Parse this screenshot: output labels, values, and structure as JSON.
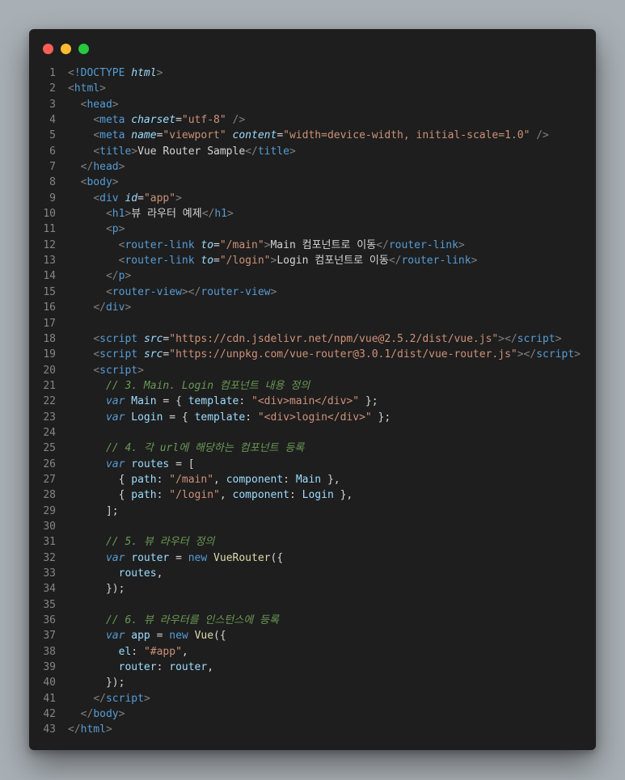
{
  "window": {
    "controls": [
      "close",
      "minimize",
      "maximize"
    ]
  },
  "lines": [
    [
      [
        "punct",
        "<"
      ],
      [
        "doctype",
        "!DOCTYPE "
      ],
      [
        "attr",
        "html"
      ],
      [
        "punct",
        ">"
      ]
    ],
    [
      [
        "punct",
        "<"
      ],
      [
        "tag",
        "html"
      ],
      [
        "punct",
        ">"
      ]
    ],
    [
      [
        "plain",
        "  "
      ],
      [
        "punct",
        "<"
      ],
      [
        "tag",
        "head"
      ],
      [
        "punct",
        ">"
      ]
    ],
    [
      [
        "plain",
        "    "
      ],
      [
        "punct",
        "<"
      ],
      [
        "tag",
        "meta"
      ],
      [
        "plain",
        " "
      ],
      [
        "attr",
        "charset"
      ],
      [
        "plain",
        "="
      ],
      [
        "str",
        "\"utf-8\""
      ],
      [
        "plain",
        " "
      ],
      [
        "punct",
        "/>"
      ]
    ],
    [
      [
        "plain",
        "    "
      ],
      [
        "punct",
        "<"
      ],
      [
        "tag",
        "meta"
      ],
      [
        "plain",
        " "
      ],
      [
        "attr",
        "name"
      ],
      [
        "plain",
        "="
      ],
      [
        "str",
        "\"viewport\""
      ],
      [
        "plain",
        " "
      ],
      [
        "attr",
        "content"
      ],
      [
        "plain",
        "="
      ],
      [
        "str",
        "\"width=device-width, initial-scale=1.0\""
      ],
      [
        "plain",
        " "
      ],
      [
        "punct",
        "/>"
      ]
    ],
    [
      [
        "plain",
        "    "
      ],
      [
        "punct",
        "<"
      ],
      [
        "tag",
        "title"
      ],
      [
        "punct",
        ">"
      ],
      [
        "text",
        "Vue Router Sample"
      ],
      [
        "punct",
        "</"
      ],
      [
        "tag",
        "title"
      ],
      [
        "punct",
        ">"
      ]
    ],
    [
      [
        "plain",
        "  "
      ],
      [
        "punct",
        "</"
      ],
      [
        "tag",
        "head"
      ],
      [
        "punct",
        ">"
      ]
    ],
    [
      [
        "plain",
        "  "
      ],
      [
        "punct",
        "<"
      ],
      [
        "tag",
        "body"
      ],
      [
        "punct",
        ">"
      ]
    ],
    [
      [
        "plain",
        "    "
      ],
      [
        "punct",
        "<"
      ],
      [
        "tag",
        "div"
      ],
      [
        "plain",
        " "
      ],
      [
        "attr",
        "id"
      ],
      [
        "plain",
        "="
      ],
      [
        "str",
        "\"app\""
      ],
      [
        "punct",
        ">"
      ]
    ],
    [
      [
        "plain",
        "      "
      ],
      [
        "punct",
        "<"
      ],
      [
        "tag",
        "h1"
      ],
      [
        "punct",
        ">"
      ],
      [
        "text",
        "뷰 라우터 예제"
      ],
      [
        "punct",
        "</"
      ],
      [
        "tag",
        "h1"
      ],
      [
        "punct",
        ">"
      ]
    ],
    [
      [
        "plain",
        "      "
      ],
      [
        "punct",
        "<"
      ],
      [
        "tag",
        "p"
      ],
      [
        "punct",
        ">"
      ]
    ],
    [
      [
        "plain",
        "        "
      ],
      [
        "punct",
        "<"
      ],
      [
        "tag",
        "router-link"
      ],
      [
        "plain",
        " "
      ],
      [
        "attr",
        "to"
      ],
      [
        "plain",
        "="
      ],
      [
        "str",
        "\"/main\""
      ],
      [
        "punct",
        ">"
      ],
      [
        "text",
        "Main 컴포넌트로 이동"
      ],
      [
        "punct",
        "</"
      ],
      [
        "tag",
        "router-link"
      ],
      [
        "punct",
        ">"
      ]
    ],
    [
      [
        "plain",
        "        "
      ],
      [
        "punct",
        "<"
      ],
      [
        "tag",
        "router-link"
      ],
      [
        "plain",
        " "
      ],
      [
        "attr",
        "to"
      ],
      [
        "plain",
        "="
      ],
      [
        "str",
        "\"/login\""
      ],
      [
        "punct",
        ">"
      ],
      [
        "text",
        "Login 컴포넌트로 이동"
      ],
      [
        "punct",
        "</"
      ],
      [
        "tag",
        "router-link"
      ],
      [
        "punct",
        ">"
      ]
    ],
    [
      [
        "plain",
        "      "
      ],
      [
        "punct",
        "</"
      ],
      [
        "tag",
        "p"
      ],
      [
        "punct",
        ">"
      ]
    ],
    [
      [
        "plain",
        "      "
      ],
      [
        "punct",
        "<"
      ],
      [
        "tag",
        "router-view"
      ],
      [
        "punct",
        "></"
      ],
      [
        "tag",
        "router-view"
      ],
      [
        "punct",
        ">"
      ]
    ],
    [
      [
        "plain",
        "    "
      ],
      [
        "punct",
        "</"
      ],
      [
        "tag",
        "div"
      ],
      [
        "punct",
        ">"
      ]
    ],
    [],
    [
      [
        "plain",
        "    "
      ],
      [
        "punct",
        "<"
      ],
      [
        "tag",
        "script"
      ],
      [
        "plain",
        " "
      ],
      [
        "attr",
        "src"
      ],
      [
        "plain",
        "="
      ],
      [
        "str",
        "\"https://cdn.jsdelivr.net/npm/vue@2.5.2/dist/vue.js\""
      ],
      [
        "punct",
        "></"
      ],
      [
        "tag",
        "script"
      ],
      [
        "punct",
        ">"
      ]
    ],
    [
      [
        "plain",
        "    "
      ],
      [
        "punct",
        "<"
      ],
      [
        "tag",
        "script"
      ],
      [
        "plain",
        " "
      ],
      [
        "attr",
        "src"
      ],
      [
        "plain",
        "="
      ],
      [
        "str",
        "\"https://unpkg.com/vue-router@3.0.1/dist/vue-router.js\""
      ],
      [
        "punct",
        "></"
      ],
      [
        "tag",
        "script"
      ],
      [
        "punct",
        ">"
      ]
    ],
    [
      [
        "plain",
        "    "
      ],
      [
        "punct",
        "<"
      ],
      [
        "tag",
        "script"
      ],
      [
        "punct",
        ">"
      ]
    ],
    [
      [
        "plain",
        "      "
      ],
      [
        "comment",
        "// 3. Main. Login 컴포넌트 내용 정의"
      ]
    ],
    [
      [
        "plain",
        "      "
      ],
      [
        "kw",
        "var"
      ],
      [
        "plain",
        " "
      ],
      [
        "var",
        "Main"
      ],
      [
        "plain",
        " = { "
      ],
      [
        "var",
        "template"
      ],
      [
        "plain",
        ": "
      ],
      [
        "str",
        "\"<div>main</div>\""
      ],
      [
        "plain",
        " };"
      ]
    ],
    [
      [
        "plain",
        "      "
      ],
      [
        "kw",
        "var"
      ],
      [
        "plain",
        " "
      ],
      [
        "var",
        "Login"
      ],
      [
        "plain",
        " = { "
      ],
      [
        "var",
        "template"
      ],
      [
        "plain",
        ": "
      ],
      [
        "str",
        "\"<div>login</div>\""
      ],
      [
        "plain",
        " };"
      ]
    ],
    [],
    [
      [
        "plain",
        "      "
      ],
      [
        "comment",
        "// 4. 각 url에 해당하는 컴포넌트 등록"
      ]
    ],
    [
      [
        "plain",
        "      "
      ],
      [
        "kw",
        "var"
      ],
      [
        "plain",
        " "
      ],
      [
        "var",
        "routes"
      ],
      [
        "plain",
        " = ["
      ]
    ],
    [
      [
        "plain",
        "        { "
      ],
      [
        "var",
        "path"
      ],
      [
        "plain",
        ": "
      ],
      [
        "str",
        "\"/main\""
      ],
      [
        "plain",
        ", "
      ],
      [
        "var",
        "component"
      ],
      [
        "plain",
        ": "
      ],
      [
        "var",
        "Main"
      ],
      [
        "plain",
        " },"
      ]
    ],
    [
      [
        "plain",
        "        { "
      ],
      [
        "var",
        "path"
      ],
      [
        "plain",
        ": "
      ],
      [
        "str",
        "\"/login\""
      ],
      [
        "plain",
        ", "
      ],
      [
        "var",
        "component"
      ],
      [
        "plain",
        ": "
      ],
      [
        "var",
        "Login"
      ],
      [
        "plain",
        " },"
      ]
    ],
    [
      [
        "plain",
        "      ];"
      ]
    ],
    [],
    [
      [
        "plain",
        "      "
      ],
      [
        "comment",
        "// 5. 뷰 라우터 정의"
      ]
    ],
    [
      [
        "plain",
        "      "
      ],
      [
        "kw",
        "var"
      ],
      [
        "plain",
        " "
      ],
      [
        "var",
        "router"
      ],
      [
        "plain",
        " = "
      ],
      [
        "kw2",
        "new"
      ],
      [
        "plain",
        " "
      ],
      [
        "fn",
        "VueRouter"
      ],
      [
        "plain",
        "({"
      ]
    ],
    [
      [
        "plain",
        "        "
      ],
      [
        "var",
        "routes"
      ],
      [
        "plain",
        ","
      ]
    ],
    [
      [
        "plain",
        "      });"
      ]
    ],
    [],
    [
      [
        "plain",
        "      "
      ],
      [
        "comment",
        "// 6. 뷰 라우터를 인스턴스에 등록"
      ]
    ],
    [
      [
        "plain",
        "      "
      ],
      [
        "kw",
        "var"
      ],
      [
        "plain",
        " "
      ],
      [
        "var",
        "app"
      ],
      [
        "plain",
        " = "
      ],
      [
        "kw2",
        "new"
      ],
      [
        "plain",
        " "
      ],
      [
        "fn",
        "Vue"
      ],
      [
        "plain",
        "({"
      ]
    ],
    [
      [
        "plain",
        "        "
      ],
      [
        "var",
        "el"
      ],
      [
        "plain",
        ": "
      ],
      [
        "str",
        "\"#app\""
      ],
      [
        "plain",
        ","
      ]
    ],
    [
      [
        "plain",
        "        "
      ],
      [
        "var",
        "router"
      ],
      [
        "plain",
        ": "
      ],
      [
        "var",
        "router"
      ],
      [
        "plain",
        ","
      ]
    ],
    [
      [
        "plain",
        "      });"
      ]
    ],
    [
      [
        "plain",
        "    "
      ],
      [
        "punct",
        "</"
      ],
      [
        "tag",
        "script"
      ],
      [
        "punct",
        ">"
      ]
    ],
    [
      [
        "plain",
        "  "
      ],
      [
        "punct",
        "</"
      ],
      [
        "tag",
        "body"
      ],
      [
        "punct",
        ">"
      ]
    ],
    [
      [
        "punct",
        "</"
      ],
      [
        "tag",
        "html"
      ],
      [
        "punct",
        ">"
      ]
    ]
  ],
  "colors": {
    "window_bg": "#1e1e1e",
    "page_bg": "#a9b0b5",
    "close": "#ff5f56",
    "minimize": "#ffbd2e",
    "maximize": "#27c93f"
  }
}
